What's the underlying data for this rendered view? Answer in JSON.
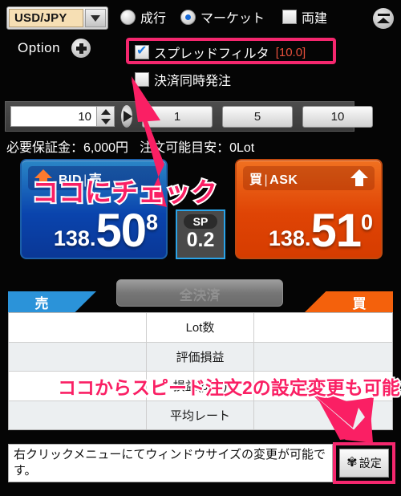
{
  "header": {
    "pair": "USD/JPY",
    "pair_dropdown_icon": "chevron-down-icon",
    "order_type_options": [
      {
        "label": "成行",
        "selected": false
      },
      {
        "label": "マーケット",
        "selected": true
      }
    ],
    "hedge_label": "両建",
    "hedge_checked": false,
    "collapse_icon": "collapse-icon"
  },
  "options": {
    "label": "Option",
    "add_icon": "plus-icon",
    "spread_filter": {
      "label": "スプレッドフィルタ",
      "value": "[10.0]",
      "checked": true
    },
    "settle_simultaneous": {
      "label": "決済同時発注",
      "checked": false
    }
  },
  "lot": {
    "quantity": "10",
    "spin_up_icon": "caret-up-icon",
    "spin_down_icon": "caret-down-icon",
    "apply_icon": "play-icon",
    "presets": [
      "1",
      "5",
      "10"
    ]
  },
  "margin": {
    "required_label": "必要保証金：",
    "required_value": "6,000円",
    "available_label": "注文可能目安：",
    "available_value": "0Lot"
  },
  "quote": {
    "bid": {
      "side_label": "売",
      "tag": "BID",
      "separator": "|",
      "integer": "138.",
      "main": "50",
      "sup": "8",
      "direction_icon": "arrow-up-icon"
    },
    "ask": {
      "side_label": "買",
      "tag": "ASK",
      "separator": "|",
      "integer": "138.",
      "main": "51",
      "sup": "0",
      "direction_icon": "arrow-up-icon"
    },
    "spread": {
      "tag": "SP",
      "value": "0.2"
    }
  },
  "positions": {
    "close_all_label": "全決済",
    "sell_tab": "売",
    "buy_tab": "買",
    "rows": [
      {
        "label": "Lot数",
        "sell": "",
        "buy": ""
      },
      {
        "label": "評価損益",
        "sell": "",
        "buy": ""
      },
      {
        "label": "損益(pips)",
        "sell": "",
        "buy": ""
      },
      {
        "label": "平均レート",
        "sell": "",
        "buy": ""
      }
    ]
  },
  "footer": {
    "hint": "右クリックメニューにてウィンドウサイズの変更が可能です。",
    "settings_label": "設定",
    "settings_icon": "gear-icon"
  },
  "annotations": [
    {
      "text": "ココにチェック"
    },
    {
      "text": "ココからスピード注文2の設定変更も可能"
    }
  ],
  "colors": {
    "accent_pink": "#fa1f64",
    "bid_blue": "#0a44ad",
    "ask_orange": "#df4405",
    "filter_value": "#e8503c"
  }
}
